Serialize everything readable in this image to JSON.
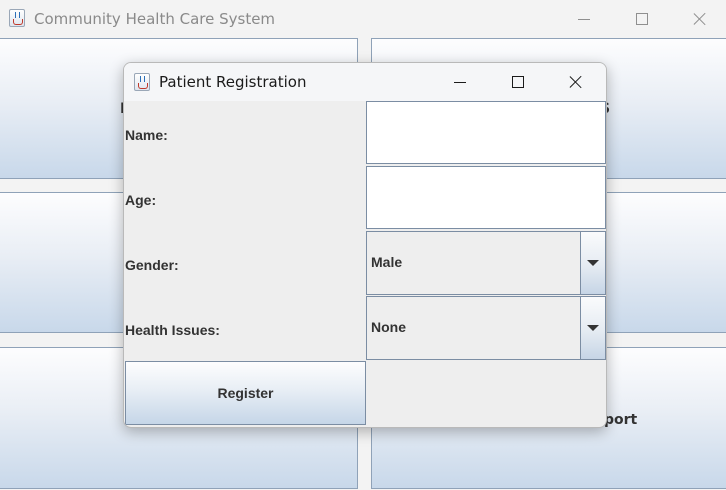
{
  "main_window": {
    "title": "Community Health Care System",
    "partial_label_left": "I",
    "partial_label_right": "S",
    "partial_label_bottom_right": "port"
  },
  "dialog": {
    "title": "Patient Registration",
    "fields": {
      "name_label": "Name:",
      "name_value": "",
      "age_label": "Age:",
      "age_value": "",
      "gender_label": "Gender:",
      "gender_selected": "Male",
      "health_issues_label": "Health Issues:",
      "health_issues_selected": "None"
    },
    "register_label": "Register"
  },
  "icons": {
    "app": "java-cup-icon",
    "minimize": "minimize-icon",
    "maximize": "maximize-icon",
    "close": "close-icon",
    "dropdown": "chevron-down-icon"
  }
}
